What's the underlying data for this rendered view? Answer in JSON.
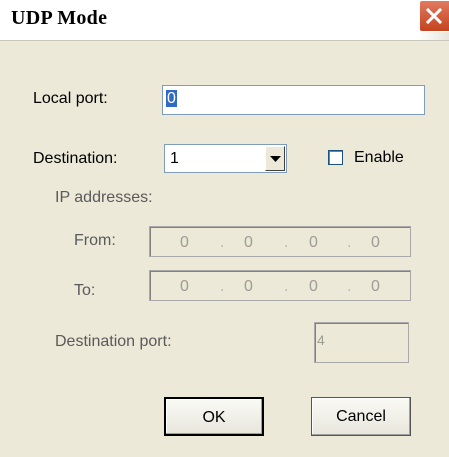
{
  "window": {
    "title": "UDP Mode",
    "close_icon": "close-icon"
  },
  "form": {
    "local_port_label": "Local port:",
    "local_port_value": "0",
    "destination_label": "Destination:",
    "destination_value": "1",
    "enable_label": "Enable",
    "enable_checked": false,
    "ip_addresses_label": "IP addresses:",
    "from_label": "From:",
    "from_octets": [
      "0",
      "0",
      "0",
      "0"
    ],
    "to_label": "To:",
    "to_octets": [
      "0",
      "0",
      "0",
      "0"
    ],
    "destination_port_label": "Destination port:",
    "destination_port_value": "4"
  },
  "buttons": {
    "ok": "OK",
    "cancel": "Cancel"
  },
  "colors": {
    "background": "#ece9d8",
    "close_button": "#c4441f",
    "selection": "#316ac5"
  }
}
